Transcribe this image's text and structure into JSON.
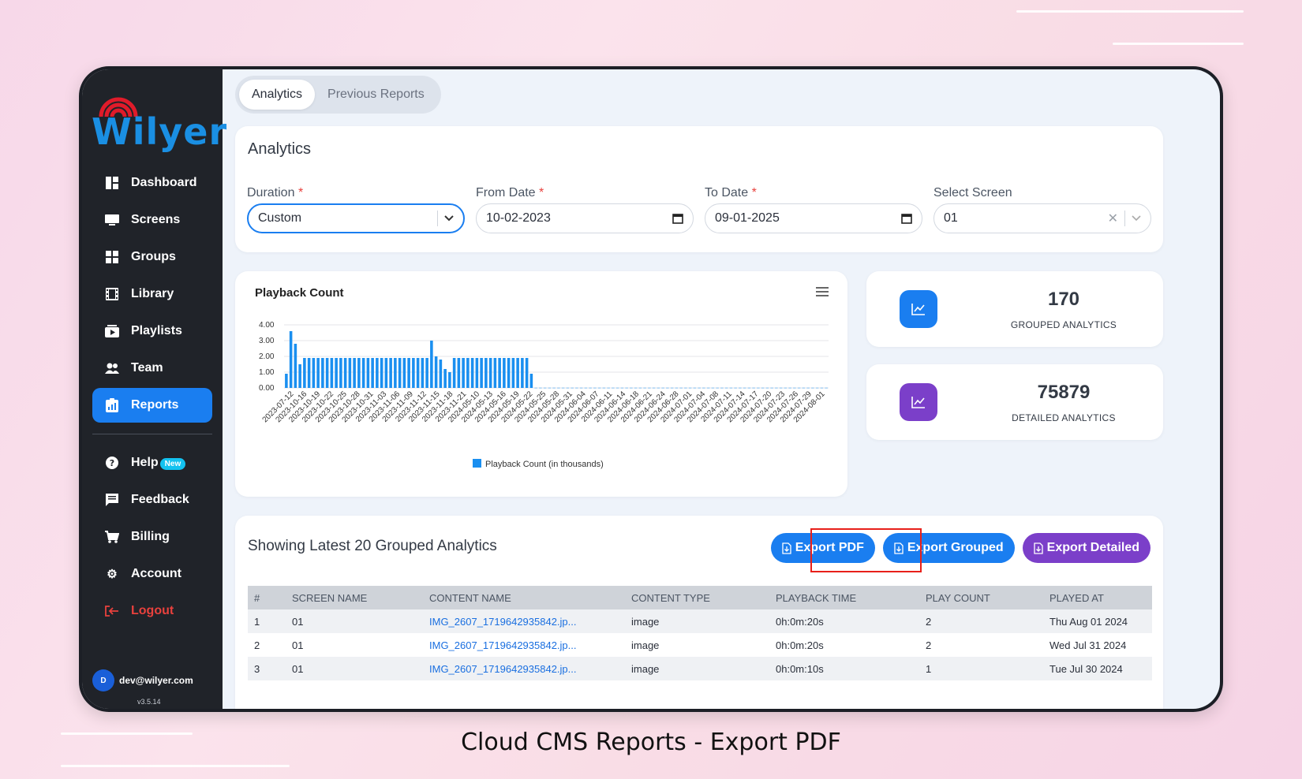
{
  "sidebar": {
    "logo_text": "Wilyer",
    "items": [
      {
        "label": "Dashboard",
        "icon": "dashboard-icon"
      },
      {
        "label": "Screens",
        "icon": "monitor-icon"
      },
      {
        "label": "Groups",
        "icon": "grid-icon"
      },
      {
        "label": "Library",
        "icon": "film-icon"
      },
      {
        "label": "Playlists",
        "icon": "playlist-icon"
      },
      {
        "label": "Team",
        "icon": "team-icon"
      },
      {
        "label": "Reports",
        "icon": "report-icon",
        "active": true
      }
    ],
    "secondary": [
      {
        "label": "Help",
        "icon": "help-icon",
        "badge": "New"
      },
      {
        "label": "Feedback",
        "icon": "feedback-icon"
      },
      {
        "label": "Billing",
        "icon": "cart-icon"
      },
      {
        "label": "Account",
        "icon": "gear-icon"
      },
      {
        "label": "Logout",
        "icon": "logout-icon"
      }
    ],
    "user_initial": "D",
    "user_email": "dev@wilyer.com",
    "version": "v3.5.14"
  },
  "tabs": [
    "Analytics",
    "Previous Reports"
  ],
  "filters": {
    "title": "Analytics",
    "duration": {
      "label": "Duration",
      "value": "Custom"
    },
    "from_date": {
      "label": "From Date",
      "value": "10-02-2023"
    },
    "to_date": {
      "label": "To Date",
      "value": "09-01-2025"
    },
    "screen": {
      "label": "Select Screen",
      "value": "01"
    }
  },
  "stats": [
    {
      "value": "170",
      "label": "GROUPED ANALYTICS",
      "color": "#1a7ef0"
    },
    {
      "value": "75879",
      "label": "DETAILED ANALYTICS",
      "color": "#7b3fc9"
    }
  ],
  "chart_data": {
    "type": "bar",
    "title": "Playback Count",
    "legend": "Playback Count (in thousands)",
    "legend_position": "bottom",
    "ylim": [
      0,
      4
    ],
    "yticks": [
      "4.00",
      "3.00",
      "2.00",
      "1.00",
      "0.00"
    ],
    "grid": true,
    "color": "#1a8ff0",
    "x_tick_labels": [
      "2023-07-12",
      "2023-10-16",
      "2023-10-19",
      "2023-10-22",
      "2023-10-25",
      "2023-10-28",
      "2023-10-31",
      "2023-11-03",
      "2023-11-06",
      "2023-11-09",
      "2023-11-12",
      "2023-11-15",
      "2023-11-18",
      "2023-11-21",
      "2024-05-10",
      "2024-05-13",
      "2024-05-16",
      "2024-05-19",
      "2024-05-22",
      "2024-05-25",
      "2024-05-28",
      "2024-05-31",
      "2024-06-04",
      "2024-06-07",
      "2024-06-11",
      "2024-06-14",
      "2024-06-18",
      "2024-06-21",
      "2024-06-24",
      "2024-06-28",
      "2024-07-01",
      "2024-07-04",
      "2024-07-08",
      "2024-07-11",
      "2024-07-14",
      "2024-07-17",
      "2024-07-20",
      "2024-07-23",
      "2024-07-26",
      "2024-07-29",
      "2024-08-01"
    ],
    "values": [
      0.9,
      3.6,
      2.8,
      1.5,
      1.9,
      1.9,
      1.9,
      1.9,
      1.9,
      1.9,
      1.9,
      1.9,
      1.9,
      1.9,
      1.9,
      1.9,
      1.9,
      1.9,
      1.9,
      1.9,
      1.9,
      1.9,
      1.9,
      1.9,
      1.9,
      1.9,
      1.9,
      1.9,
      1.9,
      1.9,
      1.9,
      1.9,
      3.0,
      2.0,
      1.8,
      1.2,
      1.0,
      1.9,
      1.9,
      1.9,
      1.9,
      1.9,
      1.9,
      1.9,
      1.9,
      1.9,
      1.9,
      1.9,
      1.9,
      1.9,
      1.9,
      1.9,
      1.9,
      1.9,
      0.9,
      0.01,
      0.01,
      0.01,
      0.01,
      0.01,
      0.01,
      0.01,
      0.01,
      0.01,
      0.01,
      0.01,
      0.01,
      0.01,
      0.01,
      0.01,
      0.01,
      0.01,
      0.01,
      0.01,
      0.01,
      0.01,
      0.01,
      0.01,
      0.01,
      0.01,
      0.01,
      0.01,
      0.01,
      0.01,
      0.01,
      0.01,
      0.01,
      0.01,
      0.01,
      0.01,
      0.01,
      0.01,
      0.01,
      0.01,
      0.01,
      0.01,
      0.01,
      0.01,
      0.01,
      0.01,
      0.01,
      0.01,
      0.01,
      0.01,
      0.01,
      0.01,
      0.01,
      0.01,
      0.01,
      0.01,
      0.01,
      0.01,
      0.01,
      0.01,
      0.01,
      0.01,
      0.01,
      0.01,
      0.01,
      0.01
    ]
  },
  "table": {
    "title": "Showing Latest 20 Grouped Analytics",
    "buttons": {
      "pdf": "Export PDF",
      "grouped": "Export Grouped",
      "detailed": "Export Detailed"
    },
    "columns": [
      "#",
      "SCREEN NAME",
      "CONTENT NAME",
      "CONTENT TYPE",
      "PLAYBACK TIME",
      "PLAY COUNT",
      "PLAYED AT"
    ],
    "rows": [
      [
        "1",
        "01",
        "IMG_2607_1719642935842.jp...",
        "image",
        "0h:0m:20s",
        "2",
        "Thu Aug 01 2024"
      ],
      [
        "2",
        "01",
        "IMG_2607_1719642935842.jp...",
        "image",
        "0h:0m:20s",
        "2",
        "Wed Jul 31 2024"
      ],
      [
        "3",
        "01",
        "IMG_2607_1719642935842.jp...",
        "image",
        "0h:0m:10s",
        "1",
        "Tue Jul 30 2024"
      ]
    ]
  },
  "caption": "Cloud CMS Reports - Export PDF"
}
